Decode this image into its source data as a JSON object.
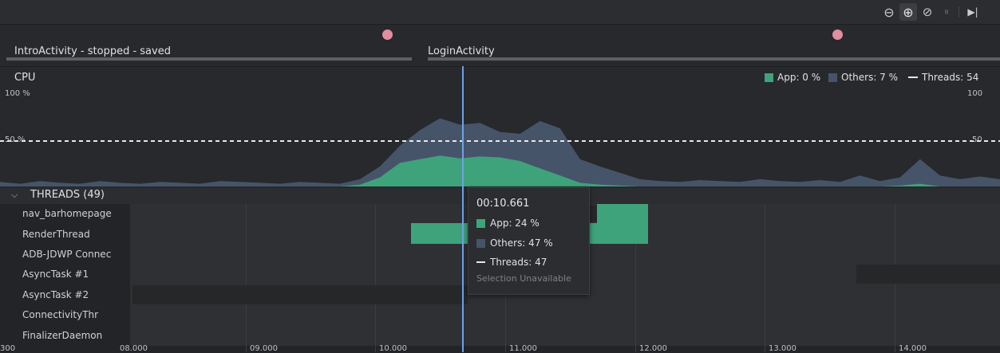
{
  "toolbar": {
    "buttons": [
      {
        "icon": "zoom-out-icon",
        "glyph": "⊖"
      },
      {
        "icon": "zoom-in-icon",
        "glyph": "⊕",
        "active": true
      },
      {
        "icon": "reset-zoom-icon",
        "glyph": "⊘"
      },
      {
        "icon": "pause-icon",
        "glyph": "⏸"
      },
      {
        "icon": "go-live-icon",
        "glyph": "▶|"
      }
    ]
  },
  "lifecycle": {
    "activities": [
      {
        "label": "IntroActivity - stopped - saved"
      },
      {
        "label": "LoginActivity"
      }
    ]
  },
  "cpu": {
    "title": "CPU",
    "left_ticks": [
      "100 %",
      "50 %"
    ],
    "right_ticks": [
      "100",
      "50"
    ],
    "legend": {
      "app": "App: 0 %",
      "others": "Others: 7 %",
      "threads": "Threads: 54"
    }
  },
  "chart_data": {
    "type": "area",
    "x": [
      0,
      2,
      4,
      6,
      8,
      10,
      12,
      14,
      16,
      18,
      20,
      22,
      24,
      26,
      28,
      30,
      32,
      34,
      36,
      38,
      40,
      42,
      44,
      46,
      48,
      50,
      52,
      54,
      56,
      58,
      60,
      62,
      64,
      66,
      68,
      70,
      72,
      74,
      76,
      78,
      80,
      82,
      84,
      86,
      88,
      90,
      92,
      94,
      96,
      98,
      100
    ],
    "series": [
      {
        "name": "Others",
        "values": [
          5,
          3,
          6,
          4,
          3,
          6,
          4,
          3,
          5,
          4,
          3,
          6,
          5,
          4,
          3,
          5,
          4,
          3,
          8,
          22,
          45,
          62,
          75,
          68,
          70,
          60,
          58,
          72,
          64,
          30,
          22,
          15,
          8,
          6,
          5,
          7,
          6,
          5,
          8,
          6,
          5,
          7,
          5,
          12,
          6,
          10,
          30,
          12,
          8,
          11,
          8
        ]
      },
      {
        "name": "App",
        "values": [
          0,
          0,
          0,
          0,
          0,
          0,
          0,
          0,
          0,
          0,
          0,
          0,
          0,
          0,
          0,
          0,
          0,
          0,
          2,
          10,
          26,
          30,
          34,
          31,
          33,
          32,
          28,
          20,
          12,
          4,
          2,
          1,
          0,
          0,
          0,
          0,
          0,
          0,
          0,
          0,
          0,
          0,
          0,
          0,
          0,
          1,
          3,
          0,
          0,
          0,
          0
        ]
      }
    ],
    "threads_line": 50,
    "ylim": [
      0,
      100
    ],
    "colors": {
      "app": "#3ea37b",
      "others": "#46546a",
      "threads": "#e8e8e8"
    }
  },
  "threads": {
    "header": "THREADS (49)",
    "names": [
      "nav_barhomepage",
      "RenderThread",
      "ADB-JDWP Connec",
      "AsyncTask #1",
      "AsyncTask #2",
      "ConnectivityThr",
      "FinalizerDaemon"
    ]
  },
  "axis": {
    "labels": [
      "300",
      "08.000",
      "09.000",
      "10.000",
      "11.000",
      "12.000",
      "13.000",
      "14.000"
    ]
  },
  "tooltip": {
    "time": "00:10.661",
    "app": "App: 24 %",
    "others": "Others: 47 %",
    "threads": "Threads: 47",
    "note": "Selection Unavailable"
  },
  "colors": {
    "app": "#3ea37b",
    "others": "#46546a",
    "cursor": "#6ea2e6",
    "event_dot": "#e08ea0"
  }
}
